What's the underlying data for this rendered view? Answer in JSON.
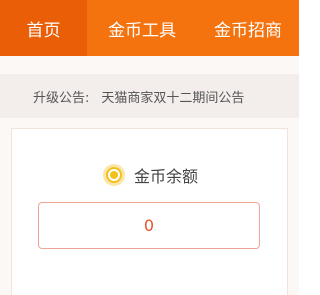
{
  "nav": {
    "tabs": [
      {
        "label": "首页"
      },
      {
        "label": "金币工具"
      },
      {
        "label": "金币招商"
      }
    ]
  },
  "notice": {
    "label": "升级公告:",
    "text": "天猫商家双十二期间公告"
  },
  "balance": {
    "label": "金币余额",
    "value": "0",
    "icon": "coin-icon"
  },
  "colors": {
    "accent": "#f5730f",
    "active_tab": "#e95e07",
    "value_text": "#e8532a",
    "coin": "#f3c01d"
  }
}
